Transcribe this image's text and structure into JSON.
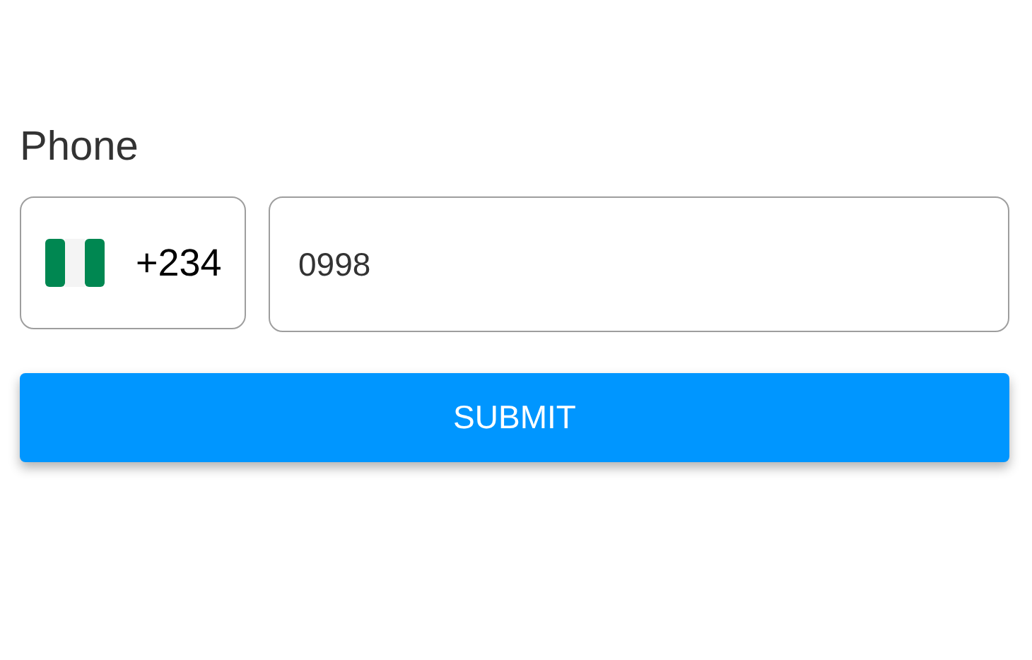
{
  "phone_field": {
    "label": "Phone",
    "country_code": "+234",
    "value": "0998"
  },
  "submit_button": {
    "label": "SUBMIT"
  }
}
